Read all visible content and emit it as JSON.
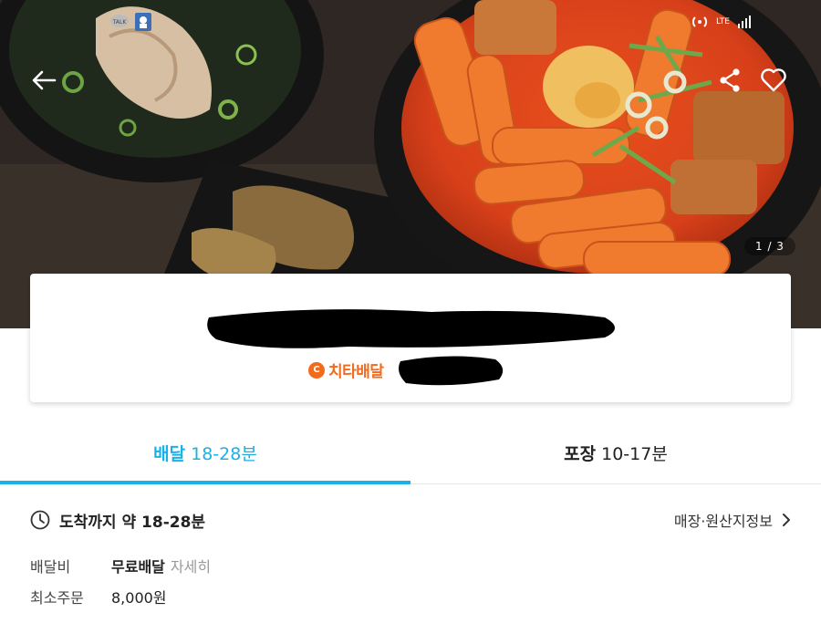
{
  "hero": {
    "page_counter": "1 / 3",
    "status_network": "LTE",
    "status_talk": "TALK"
  },
  "icons": {
    "back": "back-arrow-icon",
    "share": "share-icon",
    "favorite": "heart-outline-icon",
    "clock": "clock-icon",
    "chevron": "chevron-right-icon"
  },
  "store": {
    "name_redacted": true,
    "badge_label": "치타배달",
    "badge_logo": "C"
  },
  "tabs": [
    {
      "label": "배달",
      "time": "18-28분",
      "active": true
    },
    {
      "label": "포장",
      "time": "10-17분",
      "active": false
    }
  ],
  "info": {
    "eta": "도착까지 약 18-28분",
    "store_info_link": "매장·원산지정보",
    "delivery_fee_label": "배달비",
    "delivery_fee_value": "무료배달",
    "delivery_fee_detail": "자세히",
    "min_order_label": "최소주문",
    "min_order_value": "8,000원"
  },
  "colors": {
    "accent": "#1ab1e7",
    "cheetah_orange": "#f26a1b"
  }
}
